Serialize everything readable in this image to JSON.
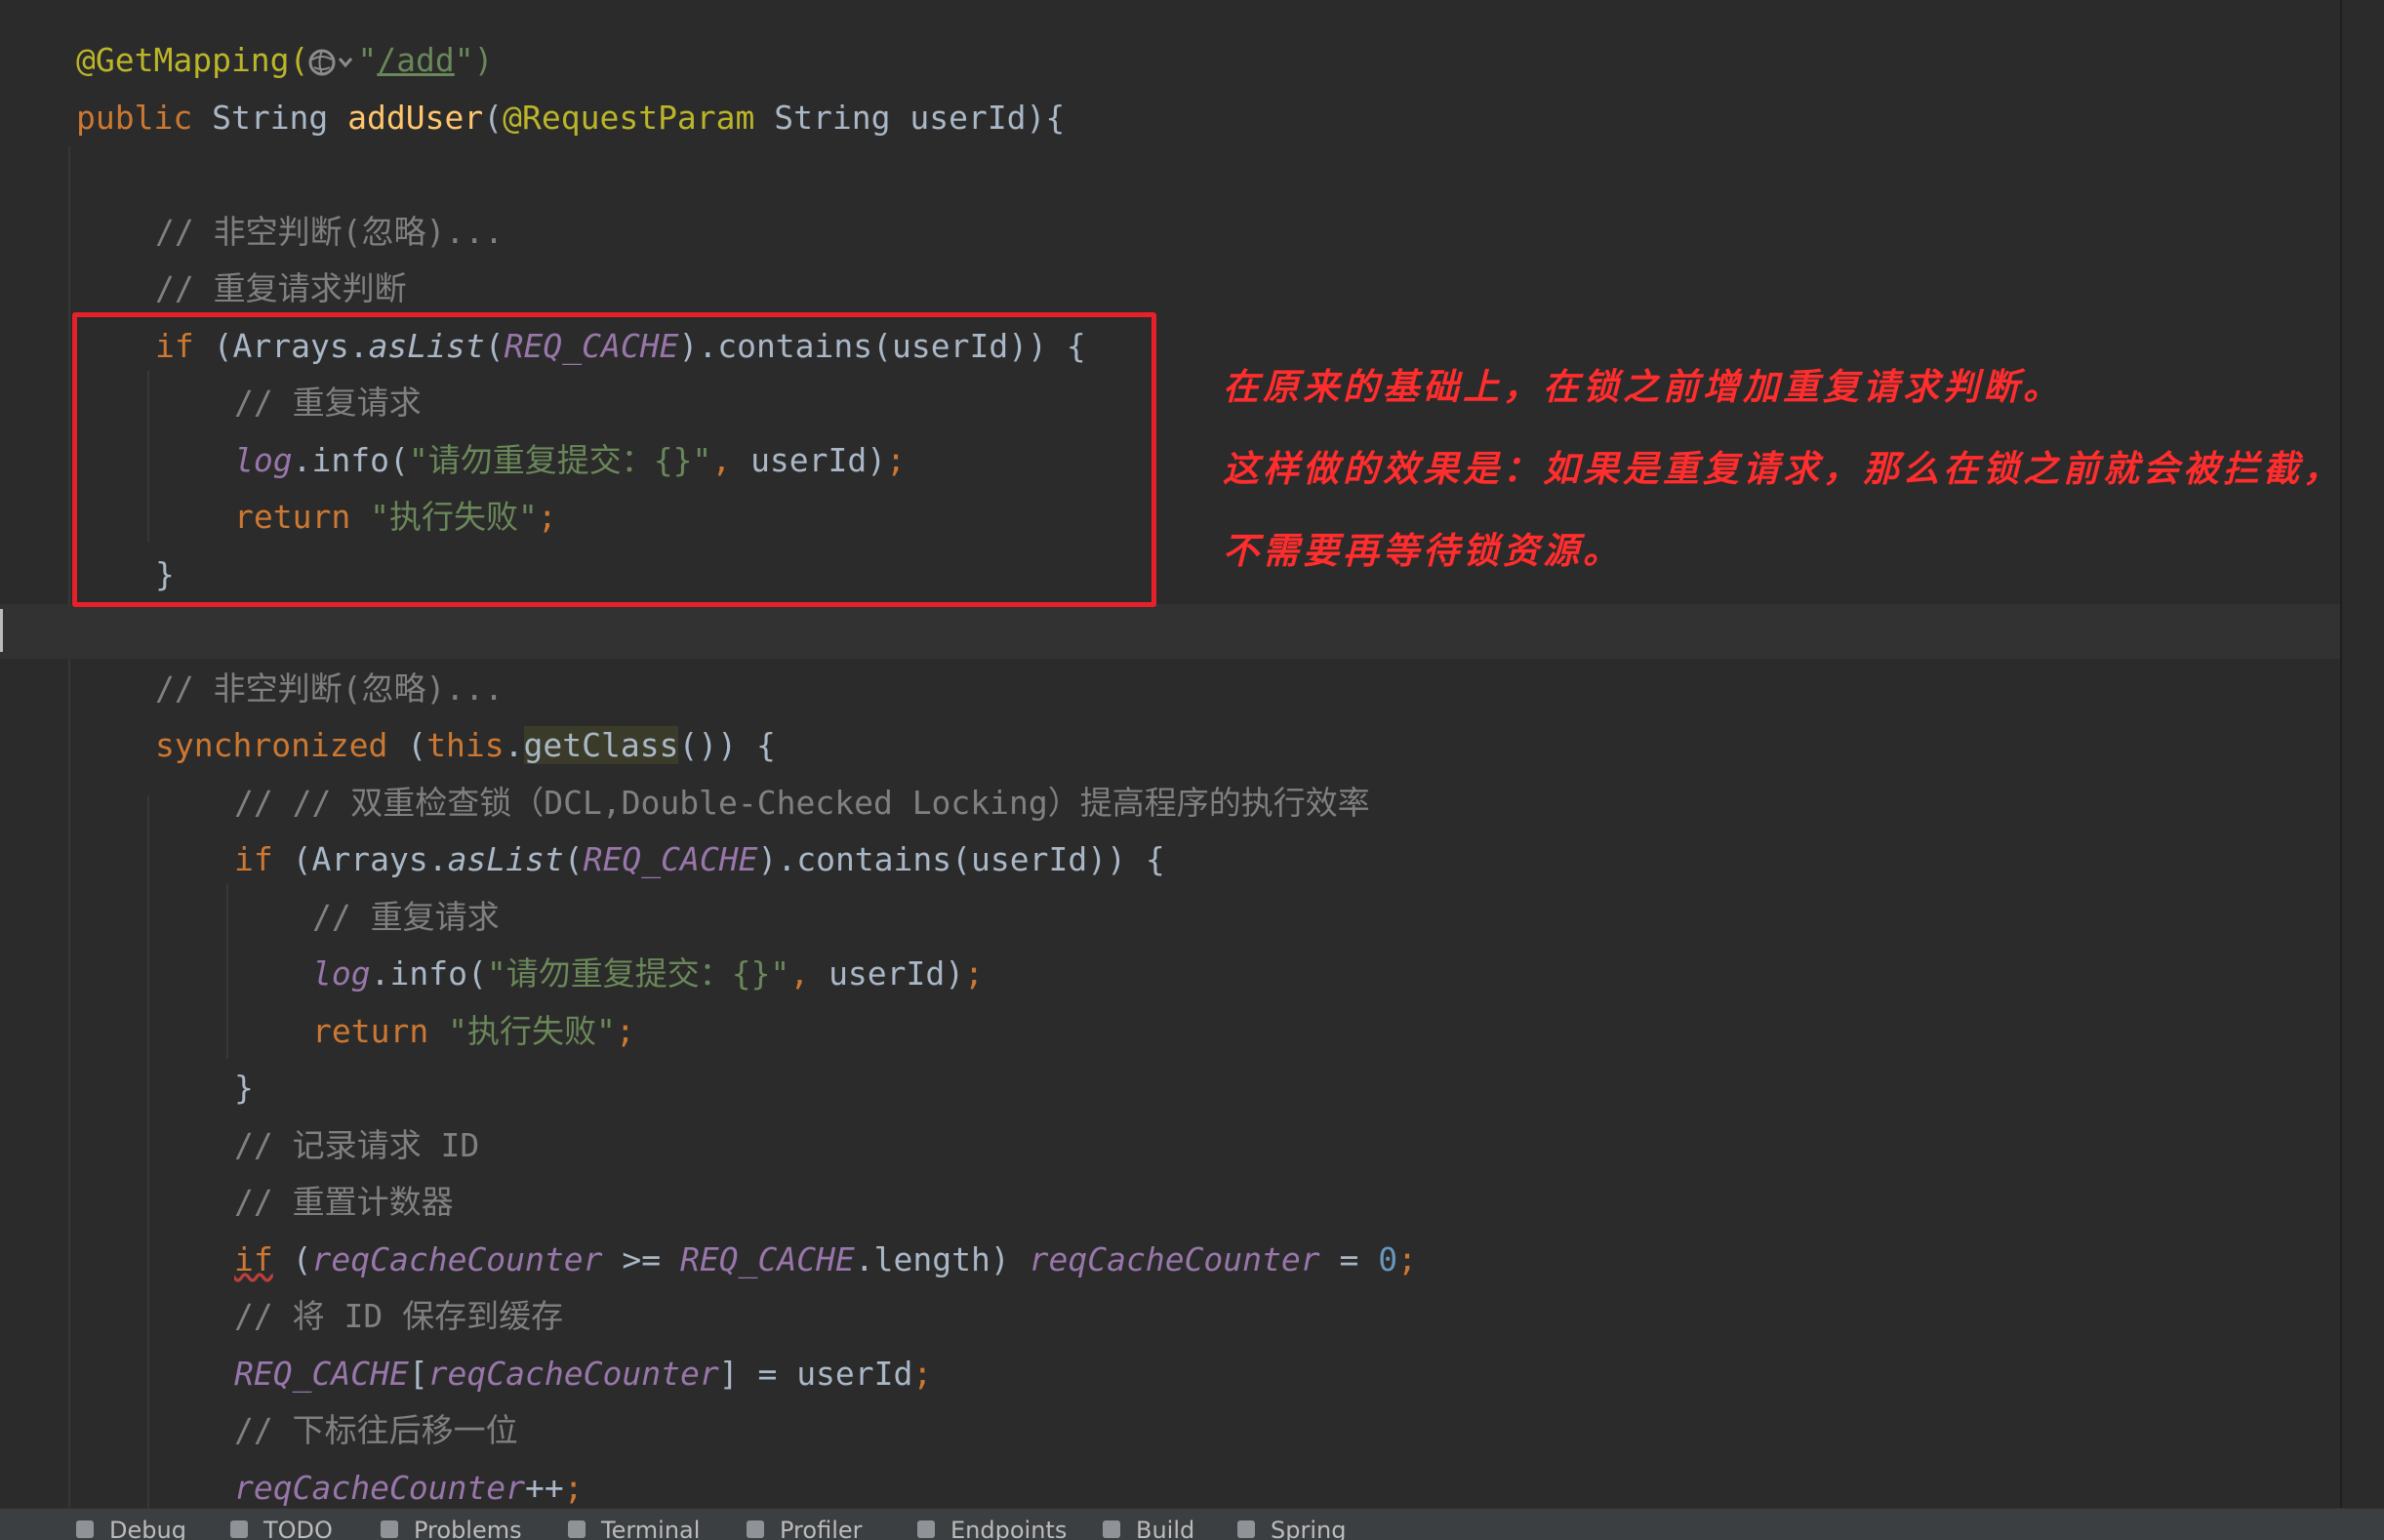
{
  "code": {
    "l1_annotation": "@GetMapping(",
    "l1_quote": "\"",
    "l1_path": "/add",
    "l1_end": "\")",
    "l2_public": "public",
    "l2_string": " String ",
    "l2_method": "addUser",
    "l2_paren": "(",
    "l2_reqparam": "@RequestParam",
    "l2_rest": " String userId){",
    "c_nonempty": "// 非空判断(忽略)...",
    "c_dup_judge": "// 重复请求判断",
    "if_kw": "if",
    "if_open": " (Arrays.",
    "aslist": "asList",
    "paren_open": "(",
    "req_cache": "REQ_CACHE",
    "contains_tail": ").contains(userId)) {",
    "c_dup": "// 重复请求",
    "log": "log",
    "info_open": ".info(",
    "log_str": "\"请勿重复提交：{}\"",
    "comma": ", ",
    "userid_close": "userId)",
    "semicolon": ";",
    "return_kw": "return",
    "fail_str": "\"执行失败\"",
    "close_brace": "}",
    "c_nonempty2": "// 非空判断(忽略)...",
    "sync_kw": "synchronized",
    "sync_open": " (",
    "this_kw": "this",
    "dot": ".",
    "getclass": "getClass",
    "sync_tail": "()) {",
    "c_dcl": "// // 双重检查锁（DCL,Double-Checked Locking）提高程序的执行效率",
    "c_record": "// 记录请求 ID",
    "c_reset": "// 重置计数器",
    "counter": "reqCacheCounter",
    "gte": " >= ",
    "length": ".length) ",
    "assign": " = ",
    "zero": "0",
    "c_save": "// 将 ID 保存到缓存",
    "bracket_open": "[",
    "bracket_close": "]",
    "userid_plain": "userId",
    "c_move": "// 下标往后移一位",
    "plusplus": "++"
  },
  "annotation_note": {
    "line1": "在原来的基础上，在锁之前增加重复请求判断。",
    "line2": "这样做的效果是：如果是重复请求，那么在锁之前就会被拦截，",
    "line3": "不需要再等待锁资源。",
    "color": "#ff2d2d"
  },
  "bottom_toolbar": {
    "items": [
      "Debug",
      "TODO",
      "Problems",
      "Terminal",
      "Profiler",
      "Endpoints",
      "Build",
      "Spring"
    ]
  },
  "colors": {
    "background": "#2b2b2b",
    "highlight_box": "#e8202a",
    "keyword": "#cc7832",
    "string": "#6a8759",
    "comment": "#808080",
    "annotation": "#bbb529",
    "method": "#ffc66d",
    "field": "#9876aa"
  },
  "icons": [
    "globe-icon",
    "chevron-down-icon"
  ]
}
